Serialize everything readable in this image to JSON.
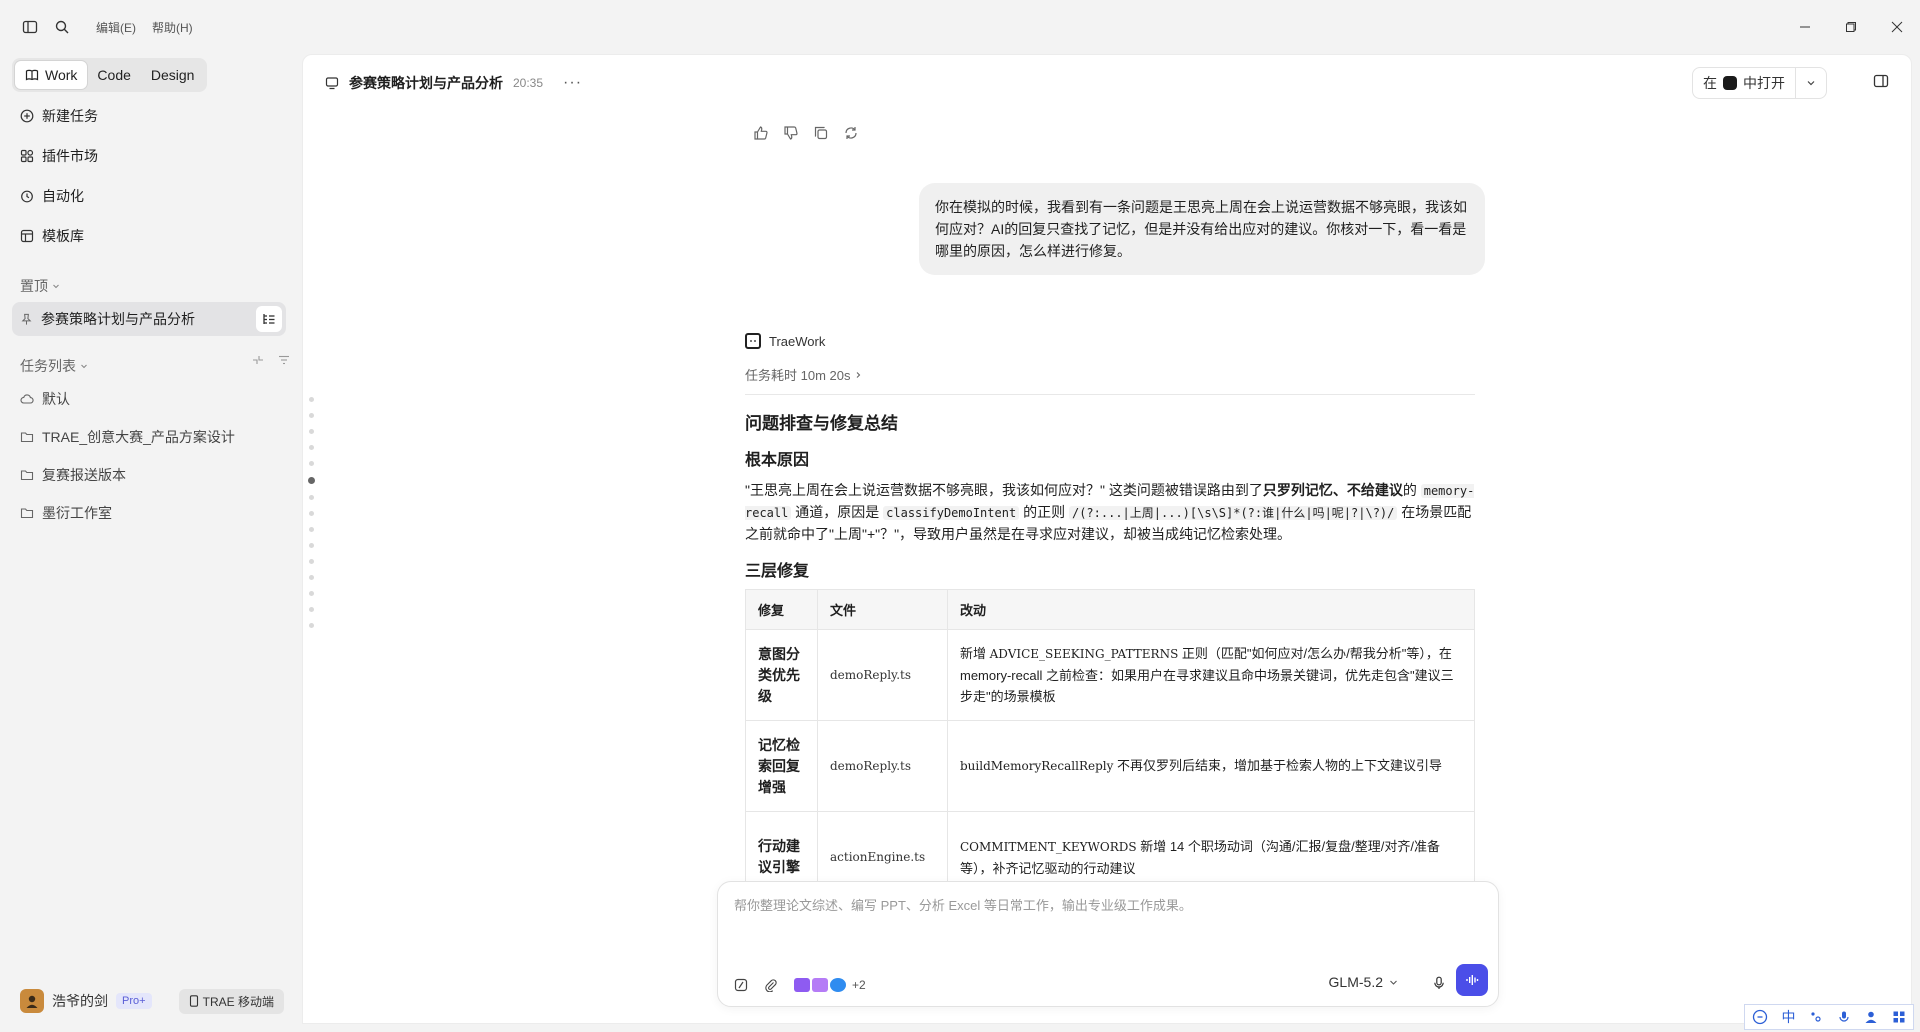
{
  "menubar": {
    "edit": "编辑(E)",
    "help": "帮助(H)"
  },
  "sidebar": {
    "modes": [
      "Work",
      "Code",
      "Design"
    ],
    "nav": [
      {
        "label": "新建任务",
        "icon": "plus-circle-icon"
      },
      {
        "label": "插件市场",
        "icon": "plugin-grid-icon"
      },
      {
        "label": "自动化",
        "icon": "clock-icon"
      },
      {
        "label": "模板库",
        "icon": "template-icon"
      }
    ],
    "pinned_label": "置顶",
    "pinned_item": "参赛策略计划与产品分析",
    "tasks_label": "任务列表",
    "tasks": [
      {
        "label": "默认",
        "icon": "cloud-icon"
      },
      {
        "label": "TRAE_创意大赛_产品方案设计",
        "icon": "folder-icon"
      },
      {
        "label": "复赛报送版本",
        "icon": "folder-icon"
      },
      {
        "label": "墨衍工作室",
        "icon": "folder-icon"
      }
    ],
    "user": {
      "name": "浩爷的剑",
      "badge": "Pro+",
      "mobile": "TRAE 移动端"
    }
  },
  "header": {
    "title": "参赛策略计划与产品分析",
    "time": "20:35",
    "more": "···",
    "open_prefix": "在",
    "open_suffix": "中打开"
  },
  "user_message": "你在模拟的时候，我看到有一条问题是王思亮上周在会上说运营数据不够亮眼，我该如何应对？AI的回复只查找了记忆，但是并没有给出应对的建议。你核对一下，看一看是哪里的原因，怎么样进行修复。",
  "agent": {
    "name": "TraeWork",
    "task_time": "任务耗时 10m 20s",
    "heading": "问题排查与修复总结",
    "root_heading": "根本原因",
    "root_p1": "\"王思亮上周在会上说运营数据不够亮眼，我该如何应对？\" 这类问题被错误路由到了",
    "root_bold": "只罗列记忆、不给建议",
    "root_p2": "的",
    "root_code1": "memory-recall",
    "root_p3": " 通道，原因是 ",
    "root_code2": "classifyDemoIntent",
    "root_p4": " 的正则 ",
    "root_code3": "/(?:...|上周|...)[\\s\\S]*(?:谁|什么|吗|呢|?|\\?)/",
    "root_p5": " 在场景匹配之前就命中了\"上周\"+\"？\"，导致用户虽然是在寻求应对建议，却被当成纯记忆检索处理。",
    "fix_heading": "三层修复",
    "table": {
      "headers": [
        "修复",
        "文件",
        "改动"
      ],
      "rows": [
        {
          "name": "意图分类优先级",
          "file": "demoReply.ts",
          "change_code": "ADVICE_SEEKING_PATTERNS",
          "change_pre": "新增 ",
          "change_post": " 正则（匹配\"如何应对/怎么办/帮我分析\"等），在 memory-recall 之前检查：如果用户在寻求建议且命中场景关键词，优先走包含\"建议三步走\"的场景模板"
        },
        {
          "name": "记忆检索回复增强",
          "file": "demoReply.ts",
          "change_code": "buildMemoryRecallReply",
          "change_pre": "",
          "change_post": " 不再仅罗列后结束，增加基于检索人物的上下文建议引导"
        },
        {
          "name": "行动建议引擎",
          "file": "actionEngine.ts",
          "change_code": "COMMITMENT_KEYWORDS",
          "change_pre": "",
          "change_post": " 新增 14 个职场动词（沟通/汇报/复盘/整理/对齐/准备等），补齐记忆驱动的行动建议"
        }
      ]
    }
  },
  "composer": {
    "placeholder": "帮你整理论文综述、编写 PPT、分析 Excel 等日常工作，输出专业级工作成果。",
    "plus_count": "+2",
    "model": "GLM-5.2"
  },
  "ime": {
    "lang": "中"
  },
  "colors": {
    "accent": "#4b4ee8",
    "sidebar_bg": "#f3f3f3",
    "bubble_bg": "#f0f0f0"
  }
}
